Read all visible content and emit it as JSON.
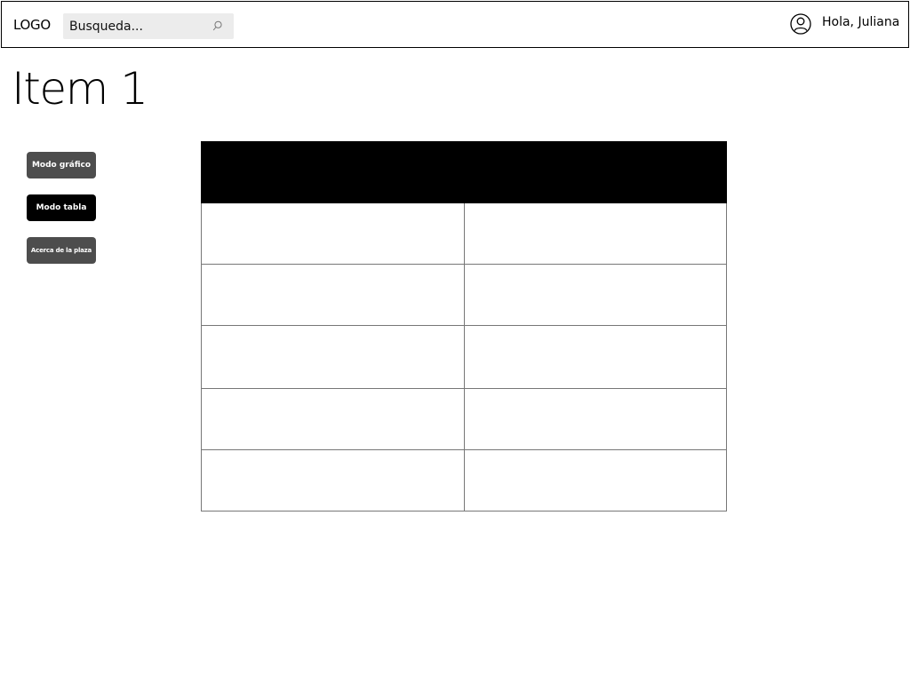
{
  "header": {
    "logo": "LOGO",
    "search": {
      "placeholder": "Busqueda...",
      "value": ""
    },
    "greeting": "Hola, Juliana"
  },
  "page": {
    "title": "Item 1"
  },
  "sidebar": {
    "buttons": [
      {
        "label": "Modo gráfico",
        "active": false
      },
      {
        "label": "Modo tabla",
        "active": true
      },
      {
        "label": "Acerca de la plaza",
        "active": false
      }
    ]
  },
  "table": {
    "headers": [
      "",
      ""
    ],
    "rows": [
      [
        "",
        ""
      ],
      [
        "",
        ""
      ],
      [
        "",
        ""
      ],
      [
        "",
        ""
      ],
      [
        "",
        ""
      ]
    ]
  },
  "colors": {
    "active_button": "#000000",
    "inactive_button": "#4d4d4d",
    "search_bg": "#ececec",
    "table_header": "#000000"
  }
}
